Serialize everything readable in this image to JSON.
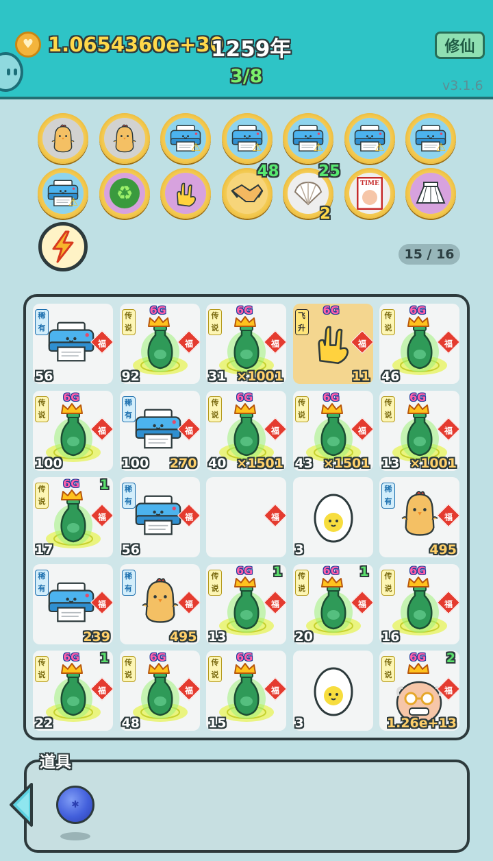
{
  "header": {
    "gold_amount": "1.0654360e+30",
    "year": "1259年",
    "stage": "3/8",
    "cultivate_button": "修仙",
    "version": "v3.1.6"
  },
  "badges": [
    {
      "icon": "chick-egg-icon",
      "bg": "gray",
      "count": "",
      "sub": ""
    },
    {
      "icon": "chick-egg-icon",
      "bg": "gray",
      "count": "",
      "sub": ""
    },
    {
      "icon": "printer-warning-icon",
      "bg": "blue",
      "count": "",
      "sub": ""
    },
    {
      "icon": "printer-warning-icon",
      "bg": "blue",
      "count": "",
      "sub": ""
    },
    {
      "icon": "printer-warning-icon",
      "bg": "blue",
      "count": "",
      "sub": ""
    },
    {
      "icon": "printer-warning-icon",
      "bg": "blue",
      "count": "",
      "sub": ""
    },
    {
      "icon": "printer-warning-icon",
      "bg": "blue",
      "count": "",
      "sub": ""
    },
    {
      "icon": "printer-warning-icon",
      "bg": "blue",
      "count": "",
      "sub": ""
    },
    {
      "icon": "recycle-icon",
      "bg": "purple",
      "count": "",
      "sub": ""
    },
    {
      "icon": "rock-hand-icon",
      "bg": "purple",
      "count": "",
      "sub": ""
    },
    {
      "icon": "handshake-icon",
      "bg": "yellow",
      "count": "48",
      "sub": ""
    },
    {
      "icon": "shell-icon",
      "bg": "white",
      "count": "25",
      "sub": "2"
    },
    {
      "icon": "time-magazine-icon",
      "bg": "white",
      "count": "",
      "sub": ""
    },
    {
      "icon": "skirt-icon",
      "bg": "purple",
      "count": "",
      "sub": ""
    }
  ],
  "slot_counter": "15 / 16",
  "fu_label": "福",
  "level_label": "6G",
  "tags": {
    "rare": "稀有",
    "legend": "传说",
    "ascend": "飞升"
  },
  "board": [
    {
      "item": "printer",
      "tag": "rare",
      "left": "56",
      "right": "",
      "top": "",
      "highlight": false
    },
    {
      "item": "vase",
      "tag": "legend",
      "left": "92",
      "right": "",
      "top": "",
      "highlight": false
    },
    {
      "item": "vase",
      "tag": "legend",
      "left": "31",
      "right": "×1001",
      "top": "",
      "highlight": false
    },
    {
      "item": "rock-hand",
      "tag": "ascend",
      "left": "",
      "right": "11",
      "top": "",
      "highlight": true
    },
    {
      "item": "vase",
      "tag": "legend",
      "left": "46",
      "right": "",
      "top": "",
      "highlight": false
    },
    {
      "item": "vase",
      "tag": "legend",
      "left": "100",
      "right": "",
      "top": "",
      "highlight": false
    },
    {
      "item": "printer",
      "tag": "rare",
      "left": "100",
      "right": "270",
      "top": "",
      "highlight": false
    },
    {
      "item": "vase",
      "tag": "legend",
      "left": "40",
      "right": "×1501",
      "top": "",
      "highlight": false
    },
    {
      "item": "vase",
      "tag": "legend",
      "left": "43",
      "right": "×1501",
      "top": "",
      "highlight": false
    },
    {
      "item": "vase",
      "tag": "legend",
      "left": "13",
      "right": "×1001",
      "top": "",
      "highlight": false
    },
    {
      "item": "vase",
      "tag": "legend",
      "left": "17",
      "right": "",
      "top": "1",
      "highlight": false
    },
    {
      "item": "printer",
      "tag": "rare",
      "left": "56",
      "right": "",
      "top": "",
      "highlight": false
    },
    {
      "item": "empty",
      "tag": "",
      "left": "",
      "right": "",
      "top": "",
      "highlight": false
    },
    {
      "item": "egg",
      "tag": "",
      "left": "3",
      "right": "",
      "top": "",
      "highlight": false
    },
    {
      "item": "chick",
      "tag": "rare",
      "left": "",
      "right": "495",
      "top": "",
      "highlight": false
    },
    {
      "item": "printer",
      "tag": "rare",
      "left": "",
      "right": "239",
      "top": "",
      "highlight": false
    },
    {
      "item": "chick",
      "tag": "rare",
      "left": "",
      "right": "495",
      "top": "",
      "highlight": false
    },
    {
      "item": "vase",
      "tag": "legend",
      "left": "13",
      "right": "",
      "top": "1",
      "highlight": false
    },
    {
      "item": "vase",
      "tag": "legend",
      "left": "20",
      "right": "",
      "top": "1",
      "highlight": false
    },
    {
      "item": "vase",
      "tag": "legend",
      "left": "16",
      "right": "",
      "top": "",
      "highlight": false
    },
    {
      "item": "vase",
      "tag": "legend",
      "left": "22",
      "right": "",
      "top": "1",
      "highlight": false
    },
    {
      "item": "vase",
      "tag": "legend",
      "left": "48",
      "right": "",
      "top": "",
      "highlight": false
    },
    {
      "item": "vase",
      "tag": "legend",
      "left": "15",
      "right": "",
      "top": "",
      "highlight": false
    },
    {
      "item": "egg",
      "tag": "",
      "left": "3",
      "right": "",
      "top": "",
      "highlight": false
    },
    {
      "item": "old-man",
      "tag": "legend",
      "left": "",
      "right": "1.26e+13",
      "top": "2",
      "highlight": false
    }
  ],
  "items_tray": {
    "title": "道具",
    "items": [
      {
        "icon": "blueberry-ball-icon"
      }
    ]
  }
}
